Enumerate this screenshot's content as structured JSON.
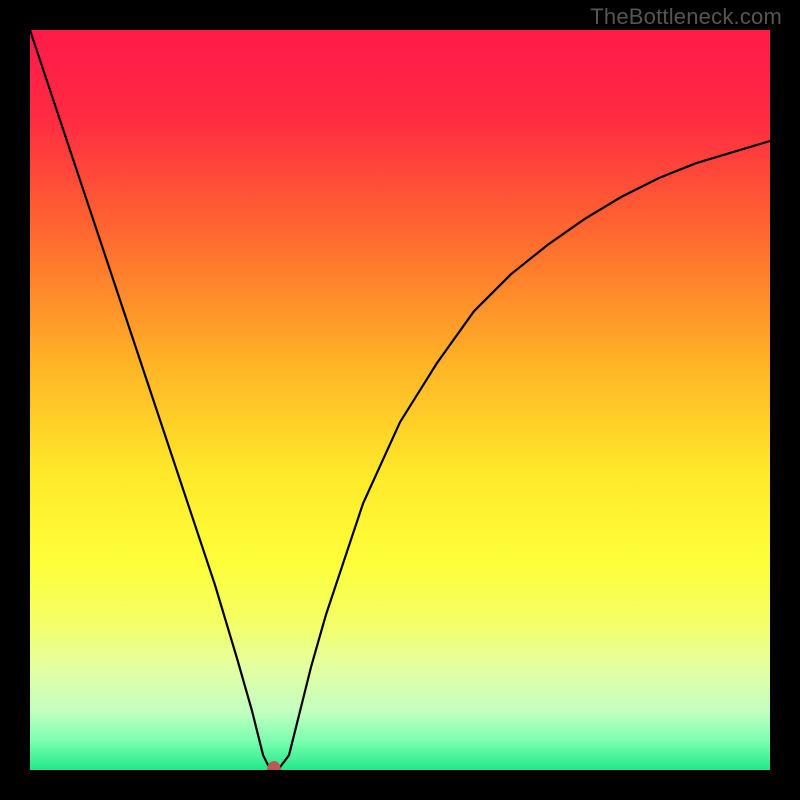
{
  "watermark": "TheBottleneck.com",
  "chart_data": {
    "type": "line",
    "title": "",
    "xlabel": "",
    "ylabel": "",
    "xlim": [
      0,
      100
    ],
    "ylim": [
      0,
      100
    ],
    "series": [
      {
        "name": "bottleneck-curve",
        "x": [
          0,
          5,
          10,
          15,
          20,
          25,
          28,
          30,
          31.5,
          32.5,
          33.5,
          35,
          36,
          37,
          38,
          40,
          45,
          50,
          55,
          60,
          65,
          70,
          75,
          80,
          85,
          90,
          95,
          100
        ],
        "values": [
          100,
          85,
          70,
          55,
          40,
          25,
          15,
          8,
          2,
          0,
          0,
          2,
          6,
          10,
          14,
          21,
          36,
          47,
          55,
          62,
          67,
          71,
          74.5,
          77.5,
          80,
          82,
          83.5,
          85
        ]
      }
    ],
    "marker": {
      "x": 33,
      "y": 0,
      "color": "#b85a56"
    },
    "gradient_stops": [
      {
        "offset": 0,
        "color": "#ff1a4a"
      },
      {
        "offset": 12,
        "color": "#ff2b42"
      },
      {
        "offset": 28,
        "color": "#ff6a2f"
      },
      {
        "offset": 45,
        "color": "#ffb326"
      },
      {
        "offset": 60,
        "color": "#ffe92a"
      },
      {
        "offset": 72,
        "color": "#fdff3a"
      },
      {
        "offset": 80,
        "color": "#f4ff66"
      },
      {
        "offset": 86,
        "color": "#e4ffa0"
      },
      {
        "offset": 92,
        "color": "#c3ffc0"
      },
      {
        "offset": 96,
        "color": "#7dffb0"
      },
      {
        "offset": 100,
        "color": "#20e88a"
      }
    ]
  }
}
